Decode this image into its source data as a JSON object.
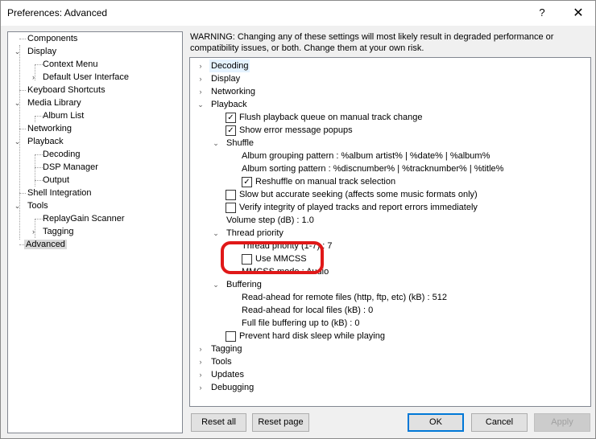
{
  "window": {
    "title": "Preferences: Advanced",
    "help_glyph": "?",
    "close_glyph": "✕"
  },
  "tree": {
    "items": [
      {
        "label": "Components"
      },
      {
        "label": "Display"
      },
      {
        "label": "Context Menu"
      },
      {
        "label": "Default User Interface"
      },
      {
        "label": "Keyboard Shortcuts"
      },
      {
        "label": "Media Library"
      },
      {
        "label": "Album List"
      },
      {
        "label": "Networking"
      },
      {
        "label": "Playback"
      },
      {
        "label": "Decoding"
      },
      {
        "label": "DSP Manager"
      },
      {
        "label": "Output"
      },
      {
        "label": "Shell Integration"
      },
      {
        "label": "Tools"
      },
      {
        "label": "ReplayGain Scanner"
      },
      {
        "label": "Tagging"
      },
      {
        "label": "Advanced"
      }
    ],
    "selected": "Advanced"
  },
  "warning": "WARNING: Changing any of these settings will most likely result in degraded performance or compatibility issues, or both. Change them at your own risk.",
  "settings": [
    {
      "label": "Decoding",
      "expander": "›"
    },
    {
      "label": "Display",
      "expander": "›"
    },
    {
      "label": "Networking",
      "expander": "›"
    },
    {
      "label": "Playback",
      "expander": "⌄"
    },
    {
      "label": "Flush playback queue on manual track change",
      "checked": true
    },
    {
      "label": "Show error message popups",
      "checked": true
    },
    {
      "label": "Shuffle",
      "expander": "⌄"
    },
    {
      "label": "Album grouping pattern : %album artist% | %date% | %album%"
    },
    {
      "label": "Album sorting pattern : %discnumber% | %tracknumber% | %title%"
    },
    {
      "label": "Reshuffle on manual track selection",
      "checked": true
    },
    {
      "label": "Slow but accurate seeking (affects some music formats only)",
      "checked": false
    },
    {
      "label": "Verify integrity of played tracks and report errors immediately",
      "checked": false
    },
    {
      "label": "Volume step (dB) : 1.0"
    },
    {
      "label": "Thread priority",
      "expander": "⌄"
    },
    {
      "label": "Thread priority (1-7) : 7"
    },
    {
      "label": "Use MMCSS",
      "checked": false
    },
    {
      "label": "MMCSS mode : Audio"
    },
    {
      "label": "Buffering",
      "expander": "⌄"
    },
    {
      "label": "Read-ahead for remote files (http, ftp, etc) (kB) : 512"
    },
    {
      "label": "Read-ahead for local files (kB) : 0"
    },
    {
      "label": "Full file buffering up to (kB) : 0"
    },
    {
      "label": "Prevent hard disk sleep while playing",
      "checked": false
    },
    {
      "label": "Tagging",
      "expander": "›"
    },
    {
      "label": "Tools",
      "expander": "›"
    },
    {
      "label": "Updates",
      "expander": "›"
    },
    {
      "label": "Debugging",
      "expander": "›"
    }
  ],
  "buttons": {
    "reset_all": "Reset all",
    "reset_page": "Reset page",
    "ok": "OK",
    "cancel": "Cancel",
    "apply": "Apply"
  },
  "colors": {
    "annotation": "#e01818",
    "selection_highlight": "#e5f3ff"
  }
}
